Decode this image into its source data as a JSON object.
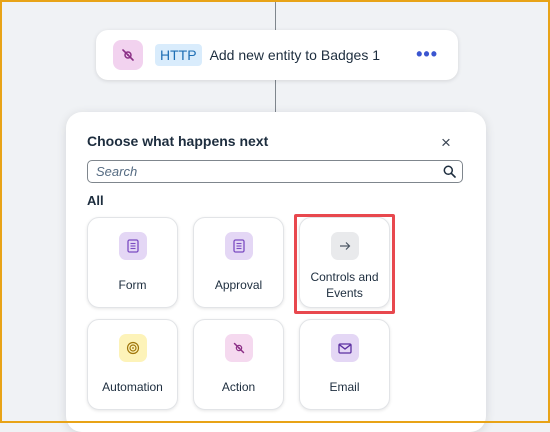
{
  "step": {
    "icon": "action-icon",
    "badge": "HTTP",
    "title": "Add new entity to Badges 1",
    "more_label": "•••"
  },
  "panel": {
    "title": "Choose what happens next",
    "close_label": "×",
    "search_placeholder": "Search",
    "section_label": "All",
    "tiles": [
      {
        "label": "Form",
        "icon": "form-icon",
        "icon_bg": "#e4d7f5"
      },
      {
        "label": "Approval",
        "icon": "approval-icon",
        "icon_bg": "#e4d7f5"
      },
      {
        "label": "Controls and Events",
        "icon": "arrow-right-icon",
        "icon_bg": "#e9eaec"
      },
      {
        "label": "Automation",
        "icon": "automation-icon",
        "icon_bg": "#fdf3b9"
      },
      {
        "label": "Action",
        "icon": "action-icon",
        "icon_bg": "#f5d9ef"
      },
      {
        "label": "Email",
        "icon": "email-icon",
        "icon_bg": "#e4d7f5"
      }
    ],
    "highlighted_tile": "Controls and Events"
  },
  "colors": {
    "frame": "#e8a317",
    "highlight": "#e8484e",
    "accent": "#3b56d0"
  }
}
